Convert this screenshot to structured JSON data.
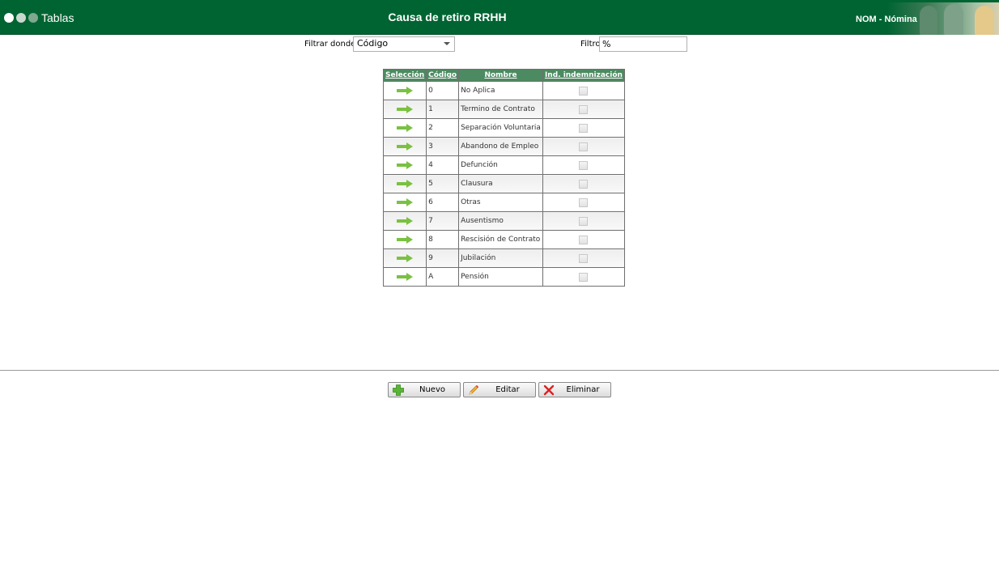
{
  "header": {
    "app_name": "Tablas",
    "title": "Causa de retiro RRHH",
    "module": "NOM - Nómina"
  },
  "filter": {
    "where_label": "Filtrar donde",
    "where_value": "Código",
    "filter_label": "Filtro",
    "filter_value": "%"
  },
  "table": {
    "columns": [
      "Selección",
      "Código",
      "Nombre",
      "Ind. indemnización"
    ],
    "rows": [
      {
        "code": "0",
        "name": "No Aplica"
      },
      {
        "code": "1",
        "name": "Termino de Contrato"
      },
      {
        "code": "2",
        "name": "Separación Voluntaria"
      },
      {
        "code": "3",
        "name": "Abandono de Empleo"
      },
      {
        "code": "4",
        "name": "Defunción"
      },
      {
        "code": "5",
        "name": "Clausura"
      },
      {
        "code": "6",
        "name": "Otras"
      },
      {
        "code": "7",
        "name": "Ausentismo"
      },
      {
        "code": "8",
        "name": "Rescisión de Contrato"
      },
      {
        "code": "9",
        "name": "Jubilación"
      },
      {
        "code": "A",
        "name": "Pensión"
      }
    ]
  },
  "actions": {
    "new_label": "Nuevo",
    "edit_label": "Editar",
    "delete_label": "Eliminar"
  },
  "colors": {
    "header_bg": "#006432",
    "table_header_bg": "#4c8a61",
    "arrow": "#7ac142"
  },
  "icons": {
    "select": "arrow-right-icon",
    "new": "plus-icon",
    "edit": "pencil-icon",
    "delete": "x-icon"
  }
}
